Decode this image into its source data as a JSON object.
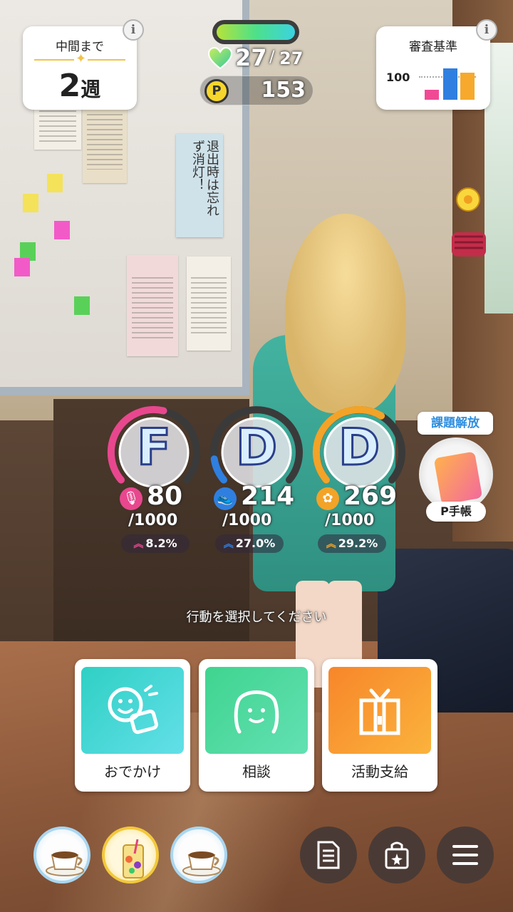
{
  "hud": {
    "midterm_label": "中間まで",
    "midterm_weeks": "2",
    "midterm_unit": "週",
    "stamina_current": "27",
    "stamina_max": "27",
    "stamina_fraction": 1.0,
    "p_points": "153",
    "coin_glyph": "P",
    "criteria_label": "審査基準",
    "criteria_value": "100",
    "info_glyph": "i"
  },
  "stats": [
    {
      "key": "vocal",
      "rank": "F",
      "value": "80",
      "max": "/1000",
      "rate": "8.2%",
      "color": "#e8478e",
      "icon": "microphone-icon",
      "fill": 0.55
    },
    {
      "key": "dance",
      "rank": "D",
      "value": "214",
      "max": "/1000",
      "rate": "27.0%",
      "color": "#2f7fe0",
      "icon": "shoe-icon",
      "fill": 0.12
    },
    {
      "key": "visual",
      "rank": "D",
      "value": "269",
      "max": "/1000",
      "rate": "29.2%",
      "color": "#f3a327",
      "icon": "visual-icon",
      "fill": 0.62
    }
  ],
  "pbook": {
    "unlock_label": "課題解放",
    "label": "P手帳"
  },
  "prompt": "行動を選択してください",
  "actions": [
    {
      "label": "おでかけ",
      "icon": "outing-icon",
      "color_from": "#2fd0c4",
      "color_to": "#63dfe8"
    },
    {
      "label": "相談",
      "icon": "consult-icon",
      "color_from": "#3fd48f",
      "color_to": "#63e0b3"
    },
    {
      "label": "活動支給",
      "icon": "gift-icon",
      "color_from": "#f7862a",
      "color_to": "#fbb33c"
    }
  ],
  "items": [
    {
      "icon": "coffee-cup-icon"
    },
    {
      "icon": "fruit-drink-icon"
    },
    {
      "icon": "coffee-cup-icon"
    }
  ],
  "menu": [
    {
      "icon": "document-icon"
    },
    {
      "icon": "item-box-icon"
    },
    {
      "icon": "hamburger-menu-icon"
    }
  ],
  "poster_text": "退出時は忘れず消灯！"
}
